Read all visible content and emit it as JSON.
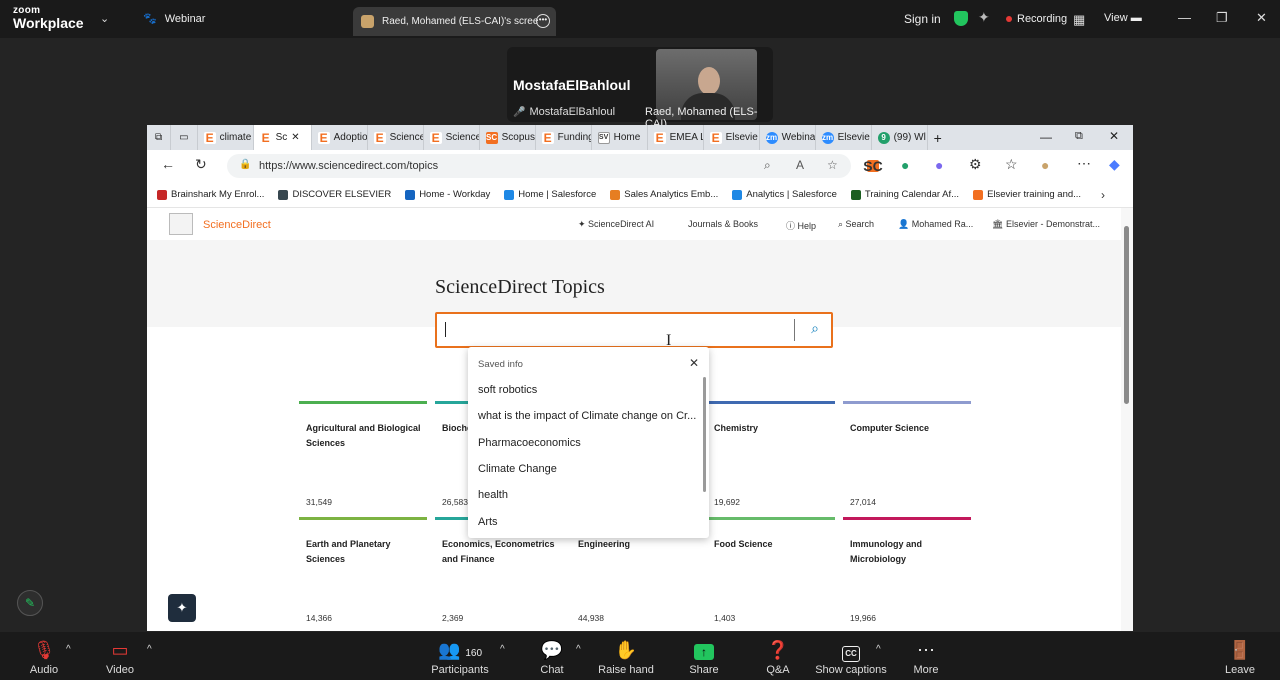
{
  "zoom": {
    "brand_small": "zoom",
    "brand_main": "Workplace",
    "webinar_label": "Webinar",
    "share_tab_label": "Raed, Mohamed (ELS-CAI)'s scree",
    "sign_in": "Sign in",
    "recording": "Recording",
    "view": "View"
  },
  "video": {
    "tile_name": "MostafaElBahloul",
    "tile_sub": "MostafaElBahloul",
    "camera_name": "Raed, Mohamed (ELS-CAI)"
  },
  "browser": {
    "tabs": [
      {
        "label": "climate",
        "icon": "e"
      },
      {
        "label": "Sc",
        "icon": "e",
        "active": true
      },
      {
        "label": "Adoptio",
        "icon": "e"
      },
      {
        "label": "Science",
        "icon": "e"
      },
      {
        "label": "Science",
        "icon": "e"
      },
      {
        "label": "Scopus",
        "icon": "sc"
      },
      {
        "label": "Funding",
        "icon": "e"
      },
      {
        "label": "Home",
        "icon": "sv"
      },
      {
        "label": "EMEA L",
        "icon": "e"
      },
      {
        "label": "Elsevie",
        "icon": "e"
      },
      {
        "label": "Webina",
        "icon": "zm"
      },
      {
        "label": "Elsevie",
        "icon": "zm"
      },
      {
        "label": "(99) Wl",
        "icon": "g"
      }
    ],
    "url": "https://www.sciencedirect.com/topics",
    "bookmarks": [
      {
        "label": "Brainshark My Enrol...",
        "color": "#c62828"
      },
      {
        "label": "DISCOVER ELSEVIER",
        "color": "#37474f"
      },
      {
        "label": "Home - Workday",
        "color": "#1565c0"
      },
      {
        "label": "Home | Salesforce",
        "color": "#1e88e5"
      },
      {
        "label": "Sales Analytics Emb...",
        "color": "#e67e22"
      },
      {
        "label": "Analytics | Salesforce",
        "color": "#1e88e5"
      },
      {
        "label": "Training Calendar Af...",
        "color": "#1b5e20"
      },
      {
        "label": "Elsevier training and...",
        "color": "#f26f21"
      }
    ]
  },
  "sciencedirect": {
    "brand": "ScienceDirect",
    "nav": [
      "ScienceDirect AI",
      "Journals & Books",
      "Help",
      "Search",
      "Mohamed Ra...",
      "Elsevier - Demonstrat..."
    ],
    "page_title": "ScienceDirect Topics",
    "search_value": ""
  },
  "dropdown": {
    "header": "Saved info",
    "items": [
      "soft robotics",
      "what is the impact of Climate change on Cr...",
      "Pharmacoeconomics",
      "Climate Change",
      "health",
      "Arts"
    ]
  },
  "cards": [
    {
      "title": "Agricultural and Biological Sciences",
      "count": "31,549",
      "color": "#4caf50"
    },
    {
      "title": "Bioche Genet Molec",
      "count": "26,583",
      "color": "#26a69a"
    },
    {
      "title": "",
      "count": "",
      "color": "#9e9e9e"
    },
    {
      "title": "Chemistry",
      "count": "19,692",
      "color": "#3f6ab1"
    },
    {
      "title": "Computer Science",
      "count": "27,014",
      "color": "#8e9bcf"
    },
    {
      "title": "Earth and Planetary Sciences",
      "count": "14,366",
      "color": "#7cb342"
    },
    {
      "title": "Economics, Econometrics and Finance",
      "count": "2,369",
      "color": "#26a69a"
    },
    {
      "title": "Engineering",
      "count": "44,938",
      "color": "#43a047"
    },
    {
      "title": "Food Science",
      "count": "1,403",
      "color": "#66bb6a"
    },
    {
      "title": "Immunology and Microbiology",
      "count": "19,966",
      "color": "#c2185b"
    }
  ],
  "toolbar": {
    "audio": "Audio",
    "video": "Video",
    "participants": "Participants",
    "participants_count": "160",
    "chat": "Chat",
    "raise_hand": "Raise hand",
    "share": "Share",
    "qa": "Q&A",
    "captions": "Show captions",
    "more": "More",
    "leave": "Leave"
  }
}
